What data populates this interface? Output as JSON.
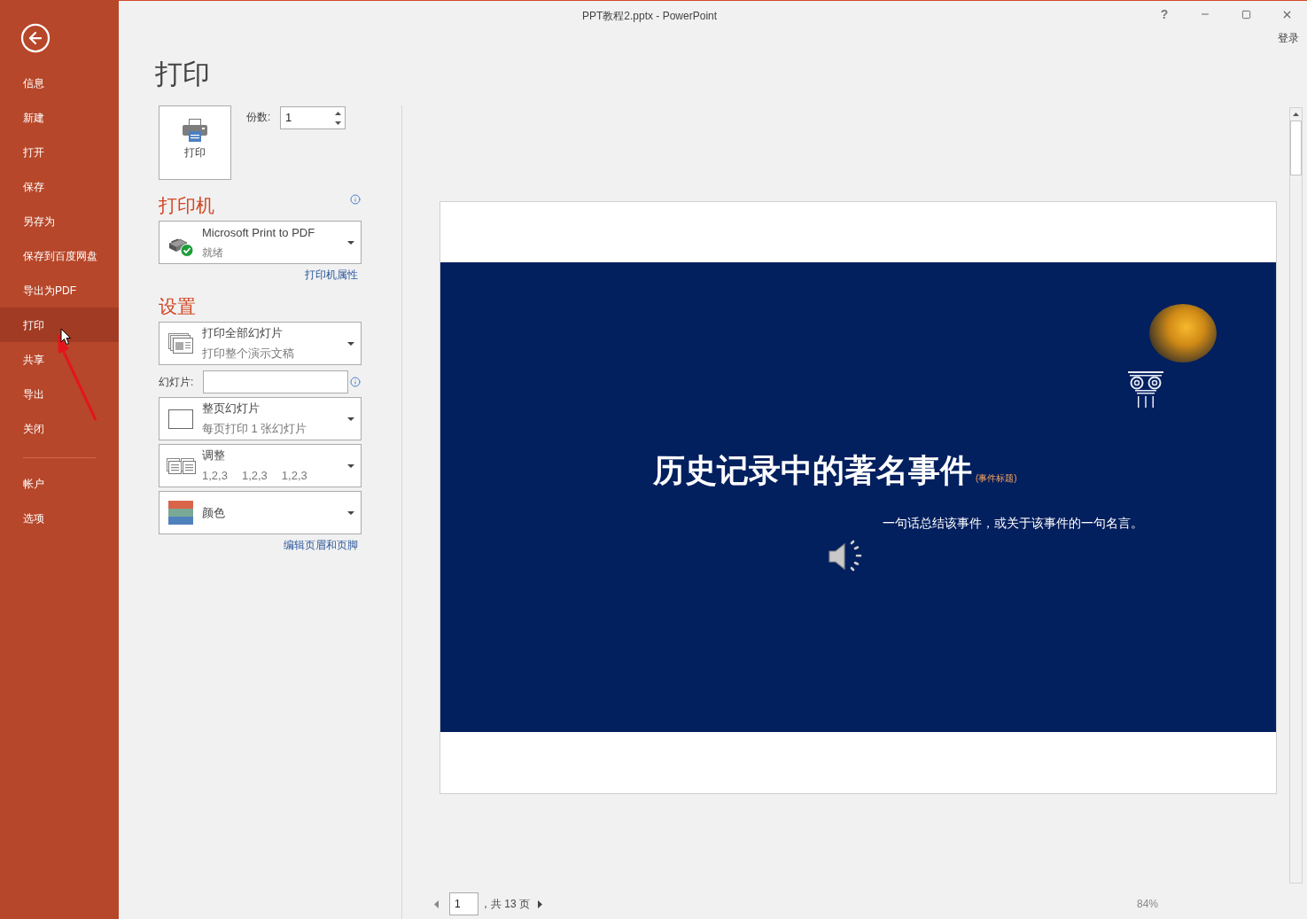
{
  "window": {
    "title": "PPT教程2.pptx - PowerPoint",
    "help": "?",
    "sign_in": "登录"
  },
  "sidebar": {
    "items": [
      {
        "label": "信息",
        "selected": false
      },
      {
        "label": "新建",
        "selected": false
      },
      {
        "label": "打开",
        "selected": false
      },
      {
        "label": "保存",
        "selected": false
      },
      {
        "label": "另存为",
        "selected": false
      },
      {
        "label": "保存到百度网盘",
        "selected": false
      },
      {
        "label": "导出为PDF",
        "selected": false
      },
      {
        "label": "打印",
        "selected": true
      },
      {
        "label": "共享",
        "selected": false
      },
      {
        "label": "导出",
        "selected": false
      },
      {
        "label": "关闭",
        "selected": false
      }
    ],
    "account_items": [
      {
        "label": "帐户",
        "selected": false
      },
      {
        "label": "选项",
        "selected": false
      }
    ]
  },
  "page_title": "打印",
  "print_button": {
    "label": "打印"
  },
  "copies": {
    "label": "份数:",
    "value": "1"
  },
  "printer": {
    "heading": "打印机",
    "name": "Microsoft Print to PDF",
    "status": "就绪",
    "link": "打印机属性"
  },
  "settings": {
    "heading": "设置",
    "items": [
      {
        "kind": "range",
        "title": "打印全部幻灯片",
        "subtitle": "打印整个演示文稿"
      },
      {
        "kind": "field",
        "label": "幻灯片:"
      },
      {
        "kind": "layout",
        "title": "整页幻灯片",
        "subtitle": "每页打印 1 张幻灯片"
      },
      {
        "kind": "collate",
        "title": "调整",
        "sequences": [
          "1,2,3",
          "1,2,3",
          "1,2,3"
        ]
      },
      {
        "kind": "color",
        "title": "颜色"
      }
    ],
    "link": "编辑页眉和页脚"
  },
  "preview": {
    "slide": {
      "title": "历史记录中的著名事件",
      "title_note": "(事件标题)",
      "subtitle": "一句话总结该事件，或关于该事件的一句名言。"
    },
    "pager": {
      "page": "1",
      "total": "，共 13 页"
    },
    "zoom": "84%"
  }
}
